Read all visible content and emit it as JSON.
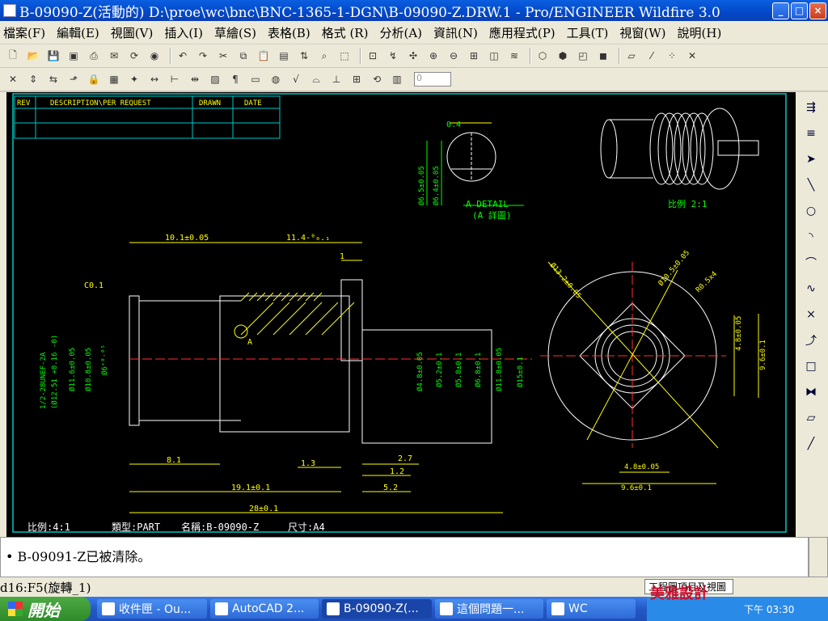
{
  "window": {
    "title": "B-09090-Z(活動的) D:\\proe\\wc\\bnc\\BNC-1365-1-DGN\\B-09090-Z.DRW.1 - Pro/ENGINEER Wildfire 3.0",
    "btn_min": "_",
    "btn_max": "□",
    "btn_close": "×"
  },
  "menu": [
    "檔案(F)",
    "編輯(E)",
    "視圖(V)",
    "插入(I)",
    "草繪(S)",
    "表格(B)",
    "格式 (R)",
    "分析(A)",
    "資訊(N)",
    "應用程式(P)",
    "工具(T)",
    "視窗(W)",
    "說明(H)"
  ],
  "toolbar": {
    "zoom_value": "0"
  },
  "drawing": {
    "rev_table": {
      "headers": [
        "REV",
        "DESCRIPTION\\PER REQUEST",
        "DRAWN",
        "DATE"
      ]
    },
    "detail_dim": "0.4",
    "detail_d1": "Ø6.5±0.05",
    "detail_d2": "Ø6.4±0.05",
    "detail_title": "A DETAIL",
    "detail_sub": "(A 詳圖)",
    "iso_scale": "比例 2:1",
    "dims": {
      "d_10_1": "10.1±0.05",
      "d_11_4": "11.4-⁰₀.₁",
      "d_1": "1",
      "c01": "C0.1",
      "thread": "1/2-28UNEF-2A",
      "thread2": "(Ø12.51 +0.16 -0)",
      "d_11_6": "Ø11.6±0.05",
      "d_10_8": "Ø10.8±0.05",
      "d_6": "Ø6⁺⁰·⁰⁵",
      "a_label": "A",
      "d_4_8": "Ø4.8±0.05",
      "d_5_2": "Ø5.2±0.1",
      "d_5_8": "Ø5.8±0.1",
      "d_6_8": "Ø6.8±0.1",
      "d_11_8": "Ø11.8±0.05",
      "d_15": "Ø15±0.1",
      "d_8_1": "8.1",
      "d_1_3": "1.3",
      "d_2_7": "2.7",
      "d_1_2": "1.2",
      "d_5_2b": "5.2",
      "d_19_1": "19.1±0.1",
      "d_28": "28±0.1",
      "r_13_2": "Ø13.2±0.05",
      "r_10_5": "Ø10.5±0.05",
      "r_r05": "R0.5x4",
      "r_4_8v": "4.8±0.05",
      "r_9_6v": "9.6±0.1",
      "r_4_8h": "4.8±0.05",
      "r_9_6h": "9.6±0.1"
    },
    "footer": {
      "scale": "比例:4:1",
      "type": "類型:PART",
      "name": "名稱:B-09090-Z",
      "size": "尺寸:A4"
    }
  },
  "message": "B-09091-Z已被清除。",
  "status": {
    "text": "d16:F5(旋轉_1)",
    "filter": "工程圖項目及視圖"
  },
  "taskbar": {
    "start": "開始",
    "tasks": [
      "收件匣 - Ou...",
      "AutoCAD 2...",
      "B-09090-Z(...",
      "這個問題一...",
      "WC"
    ]
  },
  "tray": {
    "time": "下午 03:30"
  },
  "watermark": "美雅設計",
  "colors": {
    "canvas_bg": "#000000",
    "frame": "#00c8c8",
    "geometry": "#ffffff",
    "dimension": "#ffff00",
    "title_bar": "#0348c9",
    "menu_bg": "#ece9d8"
  }
}
